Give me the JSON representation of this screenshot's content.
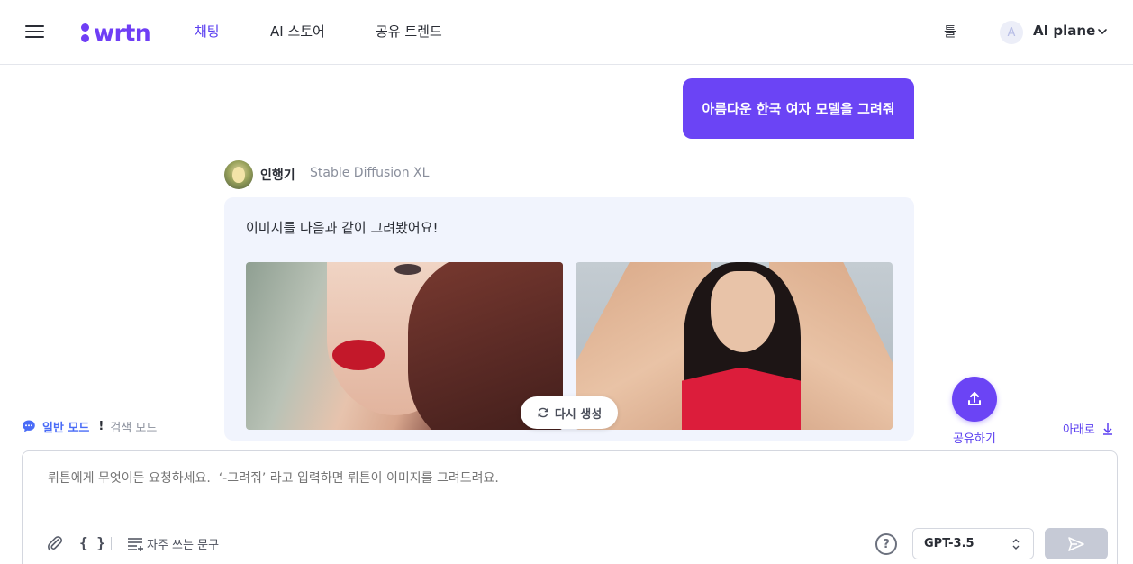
{
  "header": {
    "logo_text": "wrtn",
    "nav": {
      "chat": "채팅",
      "store": "AI 스토어",
      "trend": "공유 트렌드"
    },
    "tool": "툴",
    "avatar_initial": "A",
    "user_name": "AI plane"
  },
  "chat": {
    "user_message": "아름다운 한국 여자 모델을 그려줘",
    "bot_name": "인행기",
    "bot_model": "Stable Diffusion XL",
    "bot_message": "이미지를 다음과 같이 그려봤어요!",
    "regenerate_label": "다시 생성"
  },
  "actions": {
    "share_label": "공유하기",
    "scroll_down_label": "아래로"
  },
  "mode": {
    "normal": "일반 모드",
    "separator": "!",
    "search": "검색 모드"
  },
  "input": {
    "placeholder": "뤼튼에게 무엇이든 요청하세요.  ‘-그려줘’ 라고 입력하면 뤼튼이 이미지를 그려드려요.",
    "braces": "{ }",
    "phrases_label": "자주 쓰는 문구",
    "help": "?",
    "model": "GPT-3.5"
  },
  "colors": {
    "accent": "#6b44f5",
    "mode_blue": "#4a6cf7"
  }
}
